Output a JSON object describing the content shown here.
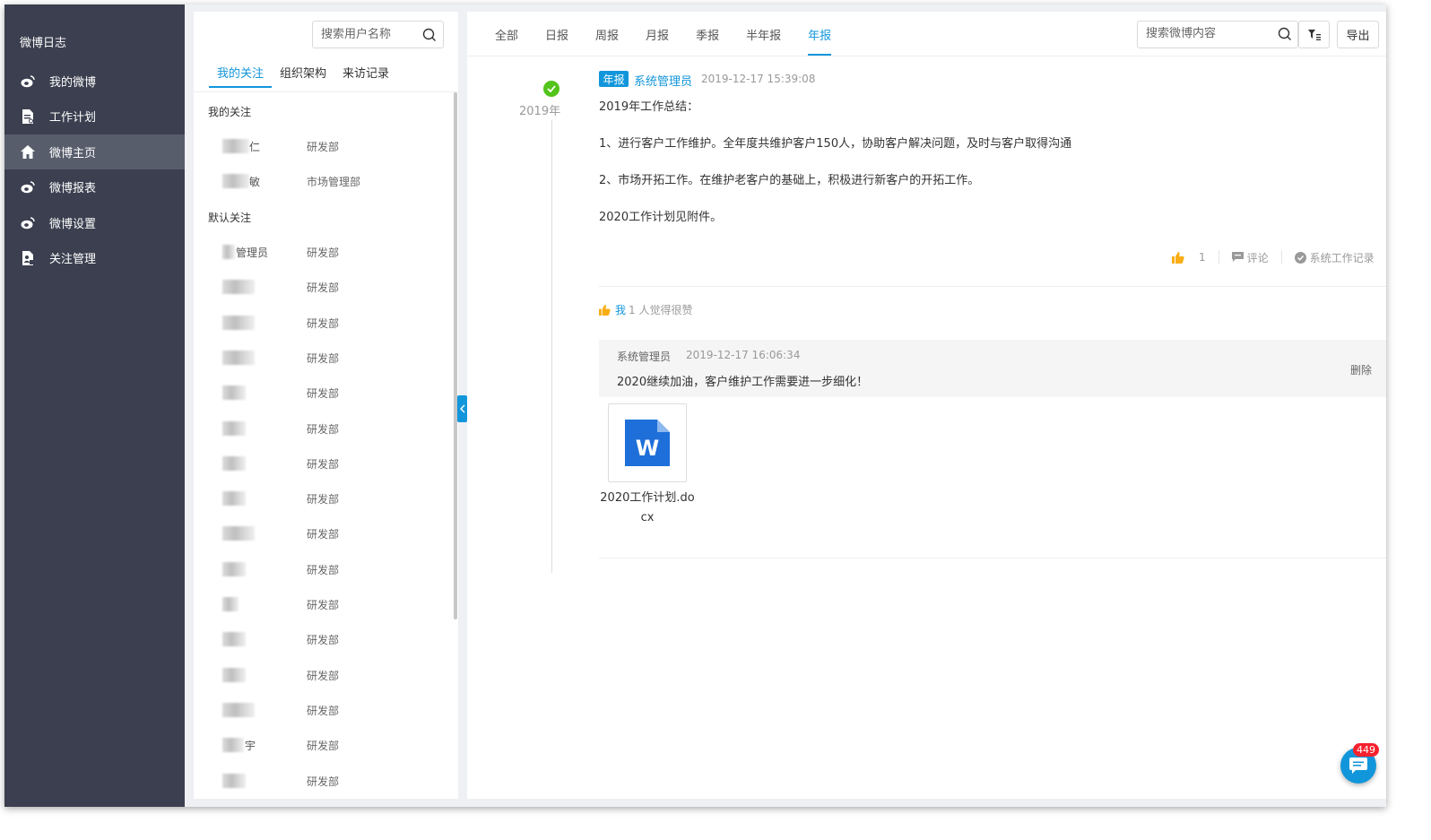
{
  "nav": {
    "title": "微博日志",
    "items": [
      {
        "label": "我的微博",
        "icon": "weibo-icon",
        "active": false
      },
      {
        "label": "工作计划",
        "icon": "document-icon",
        "active": false
      },
      {
        "label": "微博主页",
        "icon": "home-icon",
        "active": true
      },
      {
        "label": "微博报表",
        "icon": "weibo-icon",
        "active": false
      },
      {
        "label": "微博设置",
        "icon": "weibo-icon",
        "active": false
      },
      {
        "label": "关注管理",
        "icon": "user-file-icon",
        "active": false
      }
    ]
  },
  "people_panel": {
    "search_placeholder": "搜索用户名称",
    "tabs": [
      "我的关注",
      "组织架构",
      "来访记录"
    ],
    "active_tab": "我的关注",
    "my_follow_title": "我的关注",
    "my_follow": [
      {
        "name_suffix": "仁",
        "dept": "研发部"
      },
      {
        "name_suffix": "敏",
        "dept": "市场管理部"
      }
    ],
    "default_follow_title": "默认关注",
    "default_follow": [
      {
        "name_suffix": "管理员",
        "dept": "研发部"
      },
      {
        "name_suffix": "",
        "dept": "研发部"
      },
      {
        "name_suffix": "",
        "dept": "研发部"
      },
      {
        "name_suffix": "",
        "dept": "研发部"
      },
      {
        "name_suffix": "",
        "dept": "研发部"
      },
      {
        "name_suffix": "",
        "dept": "研发部"
      },
      {
        "name_suffix": "",
        "dept": "研发部"
      },
      {
        "name_suffix": "",
        "dept": "研发部"
      },
      {
        "name_suffix": "",
        "dept": "研发部"
      },
      {
        "name_suffix": "",
        "dept": "研发部"
      },
      {
        "name_suffix": "",
        "dept": "研发部"
      },
      {
        "name_suffix": "",
        "dept": "研发部"
      },
      {
        "name_suffix": "",
        "dept": "研发部"
      },
      {
        "name_suffix": "",
        "dept": "研发部"
      },
      {
        "name_suffix": "宇",
        "dept": "研发部"
      },
      {
        "name_suffix": "",
        "dept": "研发部"
      }
    ]
  },
  "main": {
    "tabs": [
      "全部",
      "日报",
      "周报",
      "月报",
      "季报",
      "半年报",
      "年报"
    ],
    "active_tab": "年报",
    "search_placeholder": "搜索微博内容",
    "export_label": "导出",
    "timeline_year": "2019年",
    "post": {
      "badge": "年报",
      "author": "系统管理员",
      "time": "2019-12-17 15:39:08",
      "lines": [
        "2019年工作总结：",
        "1、进行客户工作维护。全年度共维护客户150人，协助客户解决问题，及时与客户取得沟通",
        "2、市场开拓工作。在维护老客户的基础上，积极进行新客户的开拓工作。",
        "2020工作计划见附件。"
      ],
      "like_count": "1",
      "comment_label": "评论",
      "record_label": "系统工作记录",
      "likes_me": "我",
      "likes_text": "1 人觉得很赞",
      "comment": {
        "author": "系统管理员",
        "time": "2019-12-17 16:06:34",
        "text": "2020继续加油，客户维护工作需要进一步细化！",
        "delete_label": "删除"
      },
      "attachment": {
        "name": "2020工作计划.docx",
        "icon": "word-doc-icon"
      }
    }
  },
  "chat": {
    "badge_count": "449"
  },
  "colors": {
    "accent": "#1296db",
    "nav_bg": "#3b3f4f",
    "nav_active": "#585d6c",
    "success": "#52c41a",
    "like": "#faad14",
    "badge_red": "#f5222d"
  }
}
